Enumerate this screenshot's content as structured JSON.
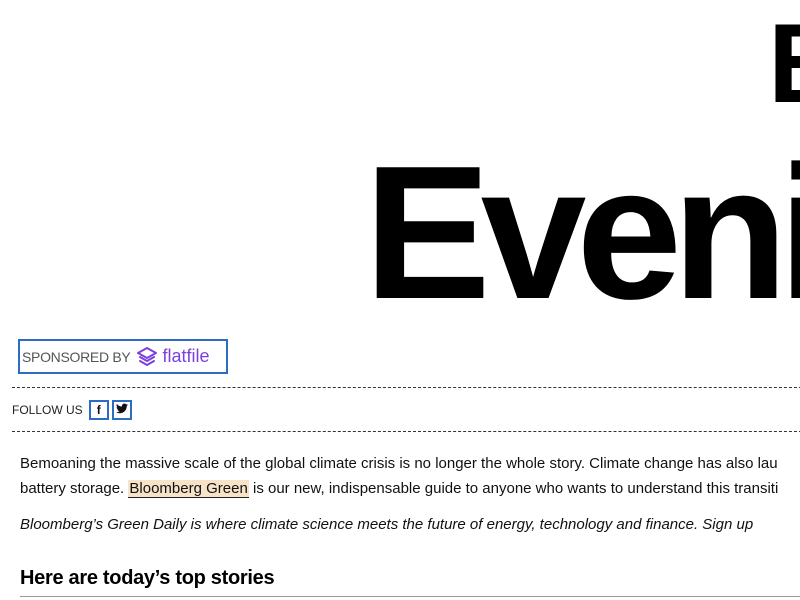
{
  "masthead": {
    "line1": "B",
    "line2": "Eveni"
  },
  "sponsor": {
    "label": "SPONSORED BY",
    "brand": "flatfile",
    "brand_color": "#7c3fe0",
    "logo_icon": "flatfile-layers-icon"
  },
  "follow": {
    "label": "FOLLOW US",
    "facebook_icon": "facebook-icon",
    "facebook_glyph": "f",
    "twitter_icon": "twitter-icon"
  },
  "intro": {
    "line1": "Bemoaning the massive scale of the global climate crisis is no longer the whole story. Climate change has also lau",
    "line2_before": "battery storage. ",
    "link_text": "Bloomberg Green",
    "line2_after": " is our new, indispensable guide to anyone who wants to understand this transiti"
  },
  "tagline": "Bloomberg’s Green Daily is where climate science meets the future of energy, technology and finance. Sign up",
  "section_heading": "Here are today’s top stories",
  "colors": {
    "accent_border": "#2b6cc4",
    "link_highlight": "#f6e3c8"
  }
}
